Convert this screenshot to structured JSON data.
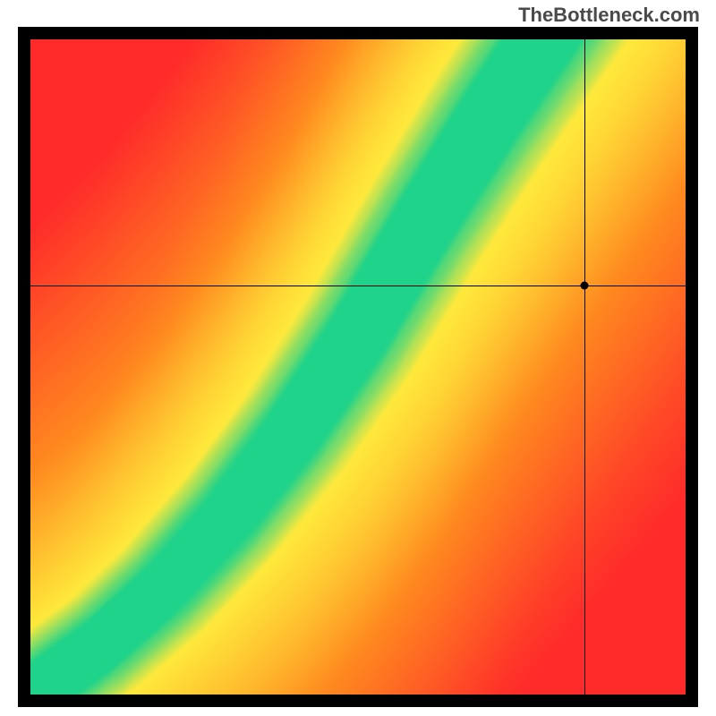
{
  "watermark": "TheBottleneck.com",
  "chart_data": {
    "type": "heatmap",
    "title": "",
    "xlabel": "",
    "ylabel": "",
    "xlim": [
      0,
      1
    ],
    "ylim": [
      0,
      1
    ],
    "grid": false,
    "legend": false,
    "colormap_note": "red-yellow-green, green along curved ridge",
    "ridge_curve": [
      {
        "x": 0.0,
        "y": 0.0
      },
      {
        "x": 0.1,
        "y": 0.07
      },
      {
        "x": 0.2,
        "y": 0.16
      },
      {
        "x": 0.3,
        "y": 0.27
      },
      {
        "x": 0.4,
        "y": 0.4
      },
      {
        "x": 0.5,
        "y": 0.55
      },
      {
        "x": 0.6,
        "y": 0.72
      },
      {
        "x": 0.7,
        "y": 0.88
      },
      {
        "x": 0.78,
        "y": 1.0
      }
    ],
    "crosshair": {
      "x": 0.845,
      "y": 0.625
    },
    "marker": {
      "x": 0.845,
      "y": 0.625
    }
  },
  "colors": {
    "red": "#ff2a2a",
    "orange": "#ff8a1f",
    "yellow": "#ffe93b",
    "green": "#1fd38a",
    "frame": "#000000"
  }
}
